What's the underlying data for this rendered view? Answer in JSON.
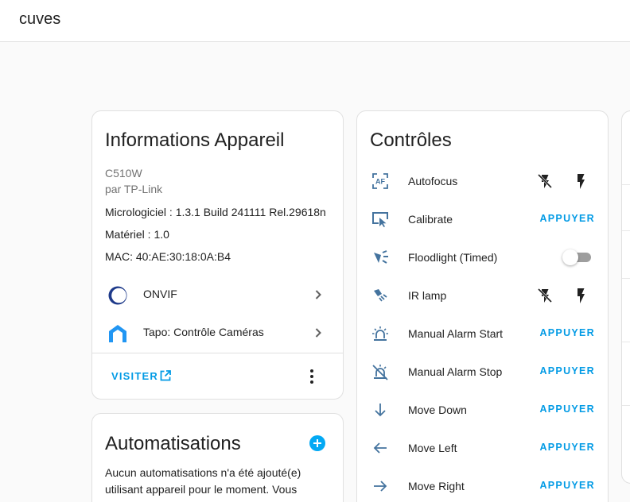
{
  "header": {
    "title": "cuves"
  },
  "colors": {
    "accent": "#039be5",
    "icon": "#44739e",
    "toggle_off": "#9e9e9e"
  },
  "device_info": {
    "title": "Informations Appareil",
    "model": "C510W",
    "manufacturer": "par TP-Link",
    "firmware": "Micrologiciel : 1.3.1 Build 241111 Rel.29618n",
    "hardware": "Matériel : 1.0",
    "mac": "MAC: 40:AE:30:18:0A:B4",
    "integrations": [
      {
        "label": "ONVIF",
        "icon": "onvif-logo-icon"
      },
      {
        "label": "Tapo: Contrôle Caméras",
        "icon": "tapo-logo-icon"
      }
    ],
    "visit_label": "VISITER"
  },
  "automations": {
    "title": "Automatisations",
    "text": "Aucun automatisations n'a été ajouté(e) utilisant appareil pour le moment. Vous pouvez en ajouter un/une en cliquant sur le"
  },
  "controls": {
    "title": "Contrôles",
    "press_label": "APPUYER",
    "rows": [
      {
        "name": "Autofocus",
        "icon": "autofocus-icon",
        "type": "flash-buttons"
      },
      {
        "name": "Calibrate",
        "icon": "calibrate-icon",
        "type": "button"
      },
      {
        "name": "Floodlight (Timed)",
        "icon": "floodlight-icon",
        "type": "toggle",
        "state": "off"
      },
      {
        "name": "IR lamp",
        "icon": "ir-lamp-icon",
        "type": "flash-buttons"
      },
      {
        "name": "Manual Alarm Start",
        "icon": "alarm-light-icon",
        "type": "button"
      },
      {
        "name": "Manual Alarm Stop",
        "icon": "alarm-light-off-icon",
        "type": "button"
      },
      {
        "name": "Move Down",
        "icon": "arrow-down-icon",
        "type": "button"
      },
      {
        "name": "Move Left",
        "icon": "arrow-left-icon",
        "type": "button"
      },
      {
        "name": "Move Right",
        "icon": "arrow-right-icon",
        "type": "button"
      }
    ]
  }
}
